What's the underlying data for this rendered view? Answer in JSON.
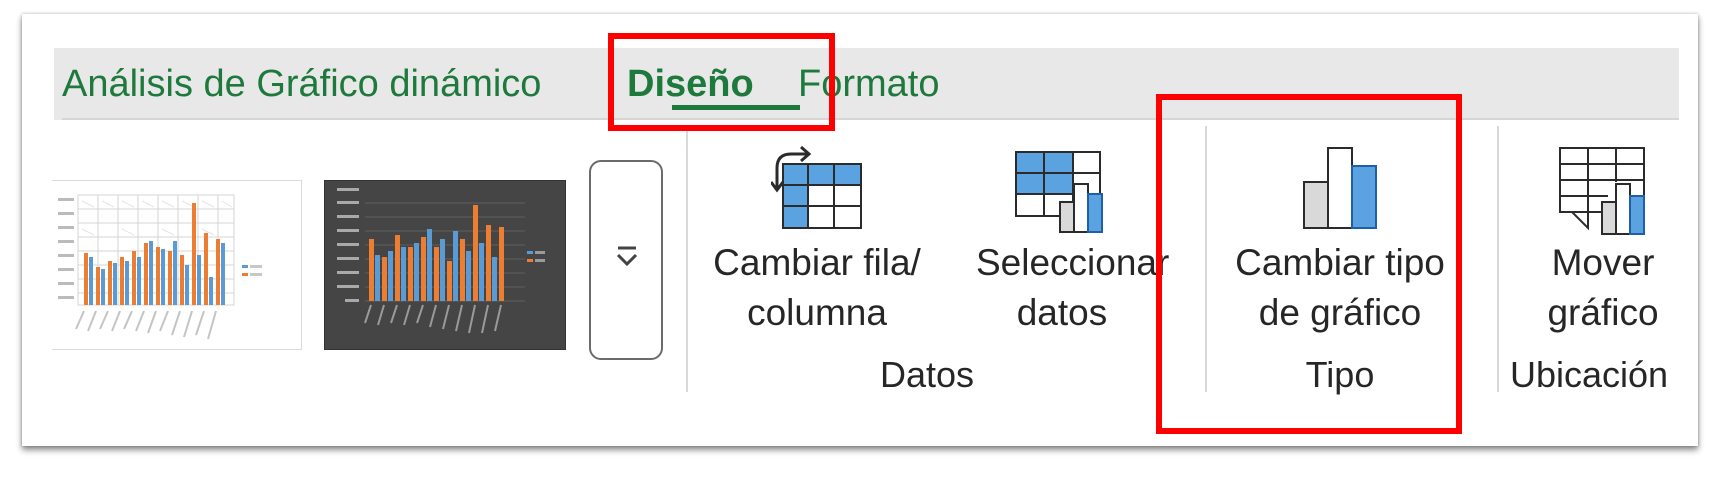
{
  "tabs": [
    {
      "label": "Análisis de Gráfico dinámico",
      "active": false
    },
    {
      "label": "Diseño",
      "active": true
    },
    {
      "label": "Formato",
      "active": false
    }
  ],
  "buttons": {
    "switch_row_column": {
      "line1": "Cambiar fila/",
      "line2": "columna",
      "icon": "switch-row-column-icon"
    },
    "select_data": {
      "line1": "Seleccionar",
      "line2": "datos",
      "icon": "select-data-icon"
    },
    "change_chart_type": {
      "line1": "Cambiar tipo",
      "line2": "de gráfico",
      "icon": "change-chart-type-icon"
    },
    "move_chart": {
      "line1": "Mover",
      "line2": "gráfico",
      "icon": "move-chart-icon"
    }
  },
  "groups": {
    "datos": "Datos",
    "tipo": "Tipo",
    "ubicacion": "Ubicación"
  },
  "colors": {
    "tab_text": "#1e7a3c",
    "highlight": "#ff0000",
    "icon_blue": "#5ba3e0",
    "icon_border": "#1f5fa8",
    "series_orange": "#ed7d31",
    "series_blue": "#5b9bd5"
  }
}
